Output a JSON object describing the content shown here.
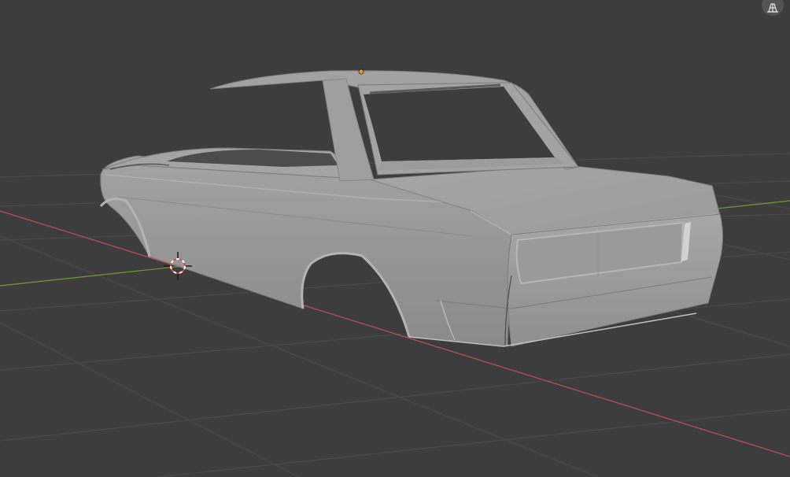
{
  "viewport": {
    "background": "#3d3d3d",
    "grid_color": "#4a4a4a",
    "x_axis_color": "#c0525a",
    "y_axis_color": "#6e9a3a"
  },
  "scene_objects": {
    "mesh": "car-body-shell",
    "mesh_color": "#9a9a9a",
    "origin_color": "#e39a34",
    "cursor": "3d-cursor"
  },
  "overlay_icons": {
    "top_right": "grid-toggle-icon"
  }
}
